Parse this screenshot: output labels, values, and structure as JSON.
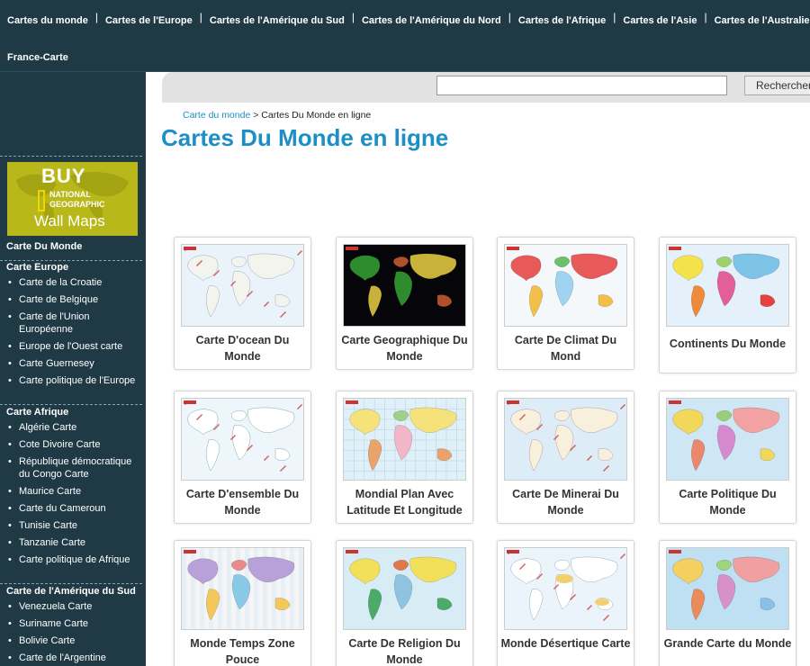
{
  "topnav": {
    "row1": [
      "Cartes du monde",
      "Cartes de l'Europe",
      "Cartes de l'Amérique du Sud",
      "Cartes de l'Amérique du Nord",
      "Cartes de l'Afrique",
      "Cartes de l'Asie",
      "Cartes de l'Australie"
    ],
    "row2": [
      "France-Carte"
    ]
  },
  "banner": {
    "line1": "BUY",
    "line2": "NATIONAL",
    "line3": "GEOGRAPHIC",
    "line4": "Wall Maps"
  },
  "sidebar": {
    "carte_du_monde": "Carte Du Monde",
    "europe": {
      "title": "Carte Europe",
      "items": [
        "Carte de la Croatie",
        "Carte de Belgique",
        "Carte de l'Union Européenne",
        "Europe de l'Ouest carte",
        "Carte Guernesey",
        "Carte politique de l'Europe"
      ]
    },
    "afrique": {
      "title": "Carte Afrique",
      "items": [
        "Algérie Carte",
        "Cote Divoire Carte",
        "République démocratique du Congo Carte",
        "Maurice Carte",
        "Carte du Cameroun",
        "Tunisie Carte",
        "Tanzanie Carte",
        "Carte politique de Afrique"
      ]
    },
    "amerique_sud": {
      "title": "Carte de l'Amérique du Sud",
      "items": [
        "Venezuela Carte",
        "Suriname Carte",
        "Bolivie Carte",
        "Carte de l'Argentine"
      ]
    }
  },
  "search": {
    "value": "",
    "placeholder": "",
    "button": "Rechercher"
  },
  "breadcrumb": {
    "link": "Carte du monde",
    "sep": ">",
    "current": "Cartes Du Monde en ligne"
  },
  "page_title": "Cartes Du Monde en ligne",
  "cards": [
    {
      "label": "Carte D'ocean Du Monde",
      "style": "ocean"
    },
    {
      "label": "Carte Geographique Du Monde",
      "style": "geo"
    },
    {
      "label": "Carte De Climat Du Mond",
      "style": "climate"
    },
    {
      "label": "Continents Du Monde",
      "style": "continents"
    },
    {
      "label": "Carte D'ensemble Du Monde",
      "style": "outline"
    },
    {
      "label": "Mondial Plan Avec Latitude Et Longitude",
      "style": "latlong"
    },
    {
      "label": "Carte De Minerai Du Monde",
      "style": "mineral"
    },
    {
      "label": "Carte Politique Du Monde",
      "style": "political"
    },
    {
      "label": "Monde Temps Zone Pouce",
      "style": "timezone"
    },
    {
      "label": "Carte De Religion Du Monde",
      "style": "religion"
    },
    {
      "label": "Monde Désertique Carte",
      "style": "desert"
    },
    {
      "label": "Grande Carte du Monde",
      "style": "big"
    }
  ],
  "colors": {
    "nav_bg": "#1f3a45",
    "accent": "#1c8fc6",
    "banner": "#b8b81a"
  }
}
